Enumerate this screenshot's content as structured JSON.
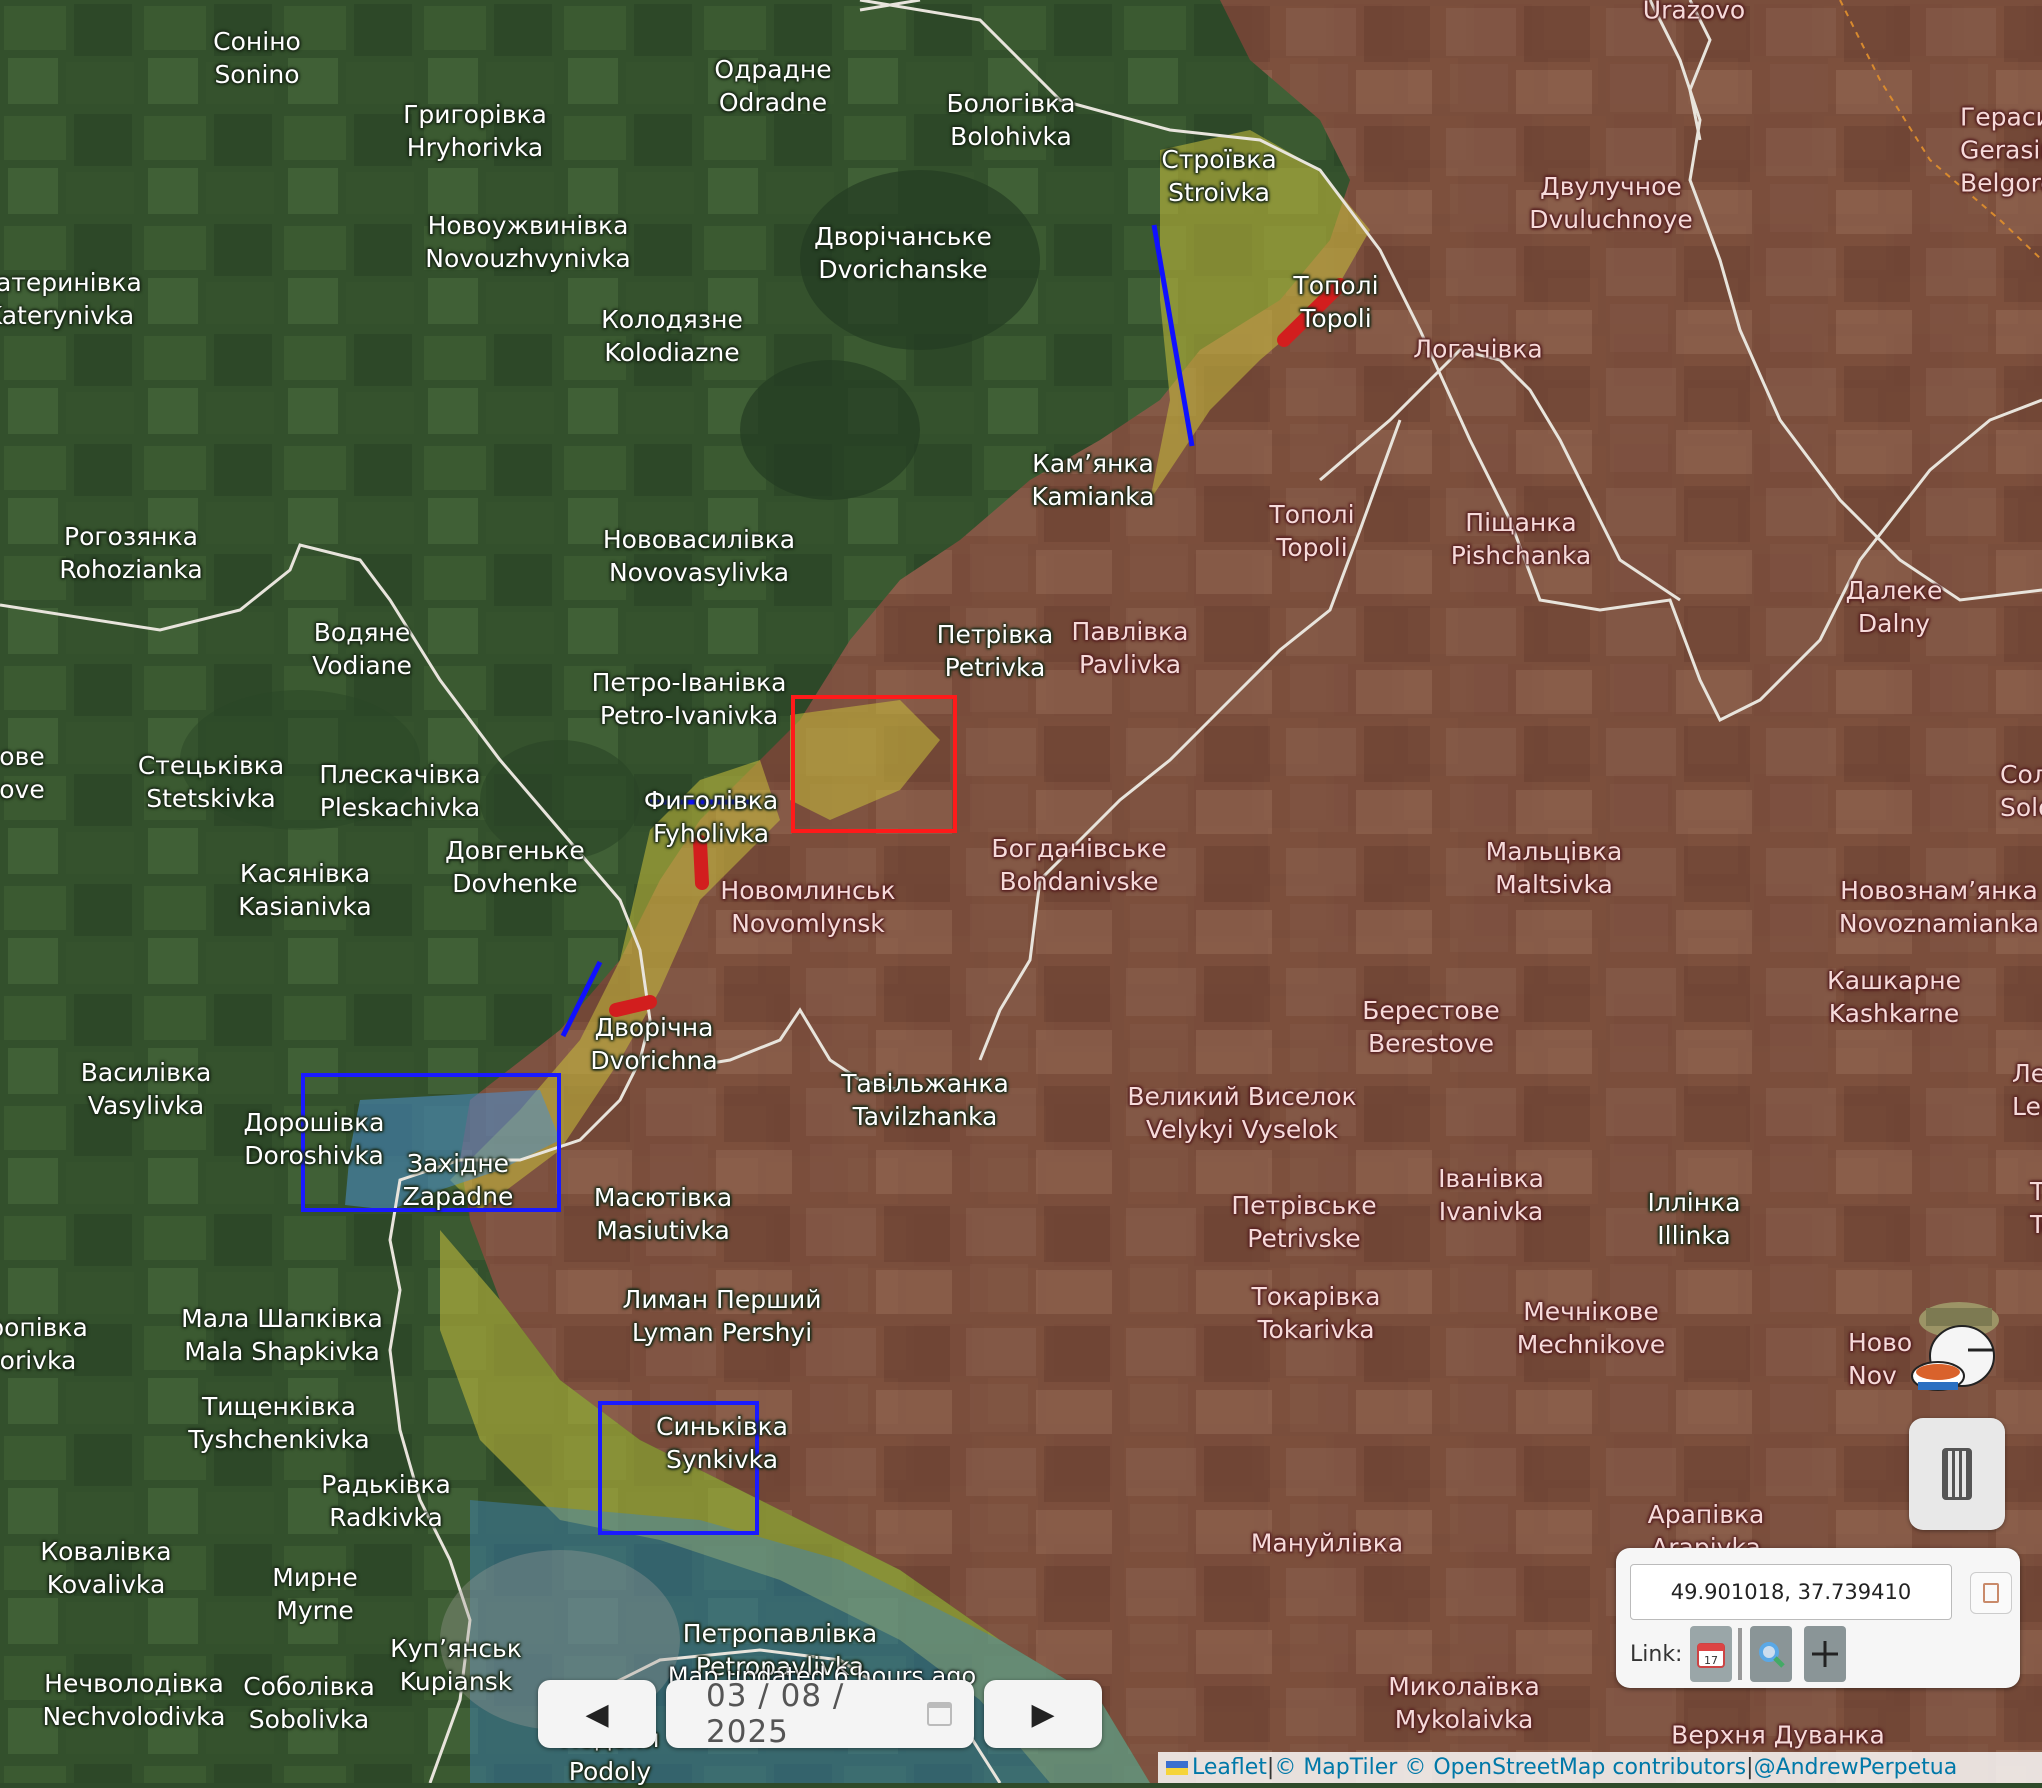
{
  "map": {
    "colors": {
      "ukraine_held": "#2f5a2c",
      "russian_occupied": "#7a3f33",
      "contested": "#b8b63a",
      "liberated": "#3f85bf",
      "border": "#e8e4dc",
      "highlight_red": "#ff0000",
      "highlight_blue": "#0000ff"
    },
    "places": [
      {
        "uk": "Соніно",
        "en": "Sonino",
        "side": "ua"
      },
      {
        "uk": "Одрадне",
        "en": "Odradne",
        "side": "ua"
      },
      {
        "uk": "Бологівка",
        "en": "Bolohivka",
        "side": "ua"
      },
      {
        "uk": "Григорівка",
        "en": "Hryhorivka",
        "side": "ua"
      },
      {
        "uk": "Строївка",
        "en": "Stroivka",
        "side": "ua"
      },
      {
        "uk": "Двулучное",
        "en": "Dvuluchnoye",
        "side": "ru"
      },
      {
        "uk": "Герасимівка",
        "en": "Gerasimovka",
        "side": "ru"
      },
      {
        "uk": "Новоужвинівка",
        "en": "Novouzhvynivka",
        "side": "ua"
      },
      {
        "uk": "Дворічанське",
        "en": "Dvorichanske",
        "side": "ua"
      },
      {
        "uk": "Катеринівка",
        "en": "Katerynivka",
        "side": "ua"
      },
      {
        "uk": "Колодязне",
        "en": "Kolodiazne",
        "side": "ua"
      },
      {
        "uk": "Тополі",
        "en": "Topoli",
        "side": "ua"
      },
      {
        "uk": "Логачівка",
        "en": "",
        "side": "ru"
      },
      {
        "uk": "Кам’янка",
        "en": "Kamianka",
        "side": "ua"
      },
      {
        "uk": "Тополі",
        "en": "Topoli",
        "side": "ru"
      },
      {
        "uk": "Піщанка",
        "en": "Pishchanka",
        "side": "ru"
      },
      {
        "uk": "Рогозянка",
        "en": "Rohozianka",
        "side": "ua"
      },
      {
        "uk": "Нововасилівка",
        "en": "Novovasylivka",
        "side": "ua"
      },
      {
        "uk": "Далеке",
        "en": "Dalny",
        "side": "ru"
      },
      {
        "uk": "Водяне",
        "en": "Vodiane",
        "side": "ua"
      },
      {
        "uk": "Петрівка",
        "en": "Petrivka",
        "side": "ua"
      },
      {
        "uk": "Павлівка",
        "en": "Pavlivka",
        "side": "ru"
      },
      {
        "uk": "Петро-Іванівка",
        "en": "Petro-Ivanivka",
        "side": "ua"
      },
      {
        "uk": "Стецьківка",
        "en": "Stetskivka",
        "side": "ua"
      },
      {
        "uk": "Плескачівка",
        "en": "Pleskachivka",
        "side": "ua"
      },
      {
        "uk": "Фиголівка",
        "en": "Fyholivka",
        "side": "ua"
      },
      {
        "uk": "Солонці",
        "en": "Solontsi",
        "side": "ru"
      },
      {
        "uk": "Богданівське",
        "en": "Bohdanivske",
        "side": "ru"
      },
      {
        "uk": "Мальцівка",
        "en": "Maltsivka",
        "side": "ru"
      },
      {
        "uk": "Касянівка",
        "en": "Kasianivka",
        "side": "ua"
      },
      {
        "uk": "Довгеньке",
        "en": "Dovhenke",
        "side": "ua"
      },
      {
        "uk": "Новомлинськ",
        "en": "Novomlynsk",
        "side": "ru"
      },
      {
        "uk": "Новознам’янка",
        "en": "Novoznamianka",
        "side": "ru"
      },
      {
        "uk": "Кашкарне",
        "en": "Kashkarne",
        "side": "ru"
      },
      {
        "uk": "Берестове",
        "en": "Berestove",
        "side": "ru"
      },
      {
        "uk": "Дворічна",
        "en": "Dvorichna",
        "side": "ua"
      },
      {
        "uk": "Василівка",
        "en": "Vasylivka",
        "side": "ua"
      },
      {
        "uk": "Тавільжанка",
        "en": "Tavilzhanka",
        "side": "ua"
      },
      {
        "uk": "Великий Виселок",
        "en": "Velykyi Vyselok",
        "side": "ru"
      },
      {
        "uk": "Дорошівка",
        "en": "Doroshivka",
        "side": "ua"
      },
      {
        "uk": "Західне",
        "en": "Zapadne",
        "side": "ua"
      },
      {
        "uk": "Іванівка",
        "en": "Ivanivka",
        "side": "ru"
      },
      {
        "uk": "Петрівське",
        "en": "Petrivske",
        "side": "ru"
      },
      {
        "uk": "Масютівка",
        "en": "Masiutivka",
        "side": "ua"
      },
      {
        "uk": "Іллінка",
        "en": "Illinka",
        "side": "ua"
      },
      {
        "uk": "Лиман Перший",
        "en": "Lyman Pershyi",
        "side": "ua"
      },
      {
        "uk": "Токарівка",
        "en": "Tokarivka",
        "side": "ru"
      },
      {
        "uk": "Мечнікове",
        "en": "Mechnikove",
        "side": "ru"
      },
      {
        "uk": "Мала Шапківка",
        "en": "Mala Shapkivka",
        "side": "ua"
      },
      {
        "uk": "Тищенківка",
        "en": "Tyshchenkivka",
        "side": "ua"
      },
      {
        "uk": "Синьківка",
        "en": "Synkivka",
        "side": "ua"
      },
      {
        "uk": "Радьківка",
        "en": "Radkivka",
        "side": "ua"
      },
      {
        "uk": "Арапівка",
        "en": "Arapivka",
        "side": "ru"
      },
      {
        "uk": "Мануйлівка",
        "en": "",
        "side": "ru"
      },
      {
        "uk": "Ковалівка",
        "en": "Kovalivka",
        "side": "ua"
      },
      {
        "uk": "Мирне",
        "en": "Myrne",
        "side": "ua"
      },
      {
        "uk": "Петропавлівка",
        "en": "Petropavlivka",
        "side": "ua"
      },
      {
        "uk": "Куп’янськ",
        "en": "Kupiansk",
        "side": "ua"
      },
      {
        "uk": "Нечволодівка",
        "en": "Nechvolodivka",
        "side": "ua"
      },
      {
        "uk": "Соболівка",
        "en": "Sobolivka",
        "side": "ua"
      },
      {
        "uk": "Миколаївка",
        "en": "Mykolaivka",
        "side": "ru"
      },
      {
        "uk": "Подоли",
        "en": "Podoly",
        "side": "ua"
      },
      {
        "uk": "Верхня Дуванка",
        "en": "",
        "side": "ru"
      },
      {
        "uk": "",
        "en": "Urazovo",
        "side": "ru"
      },
      {
        "uk": "",
        "en": "Belgorod Ob",
        "side": "ru"
      },
      {
        "uk": "Лем",
        "en": "Lem",
        "side": "ru"
      },
      {
        "uk": "То",
        "en": "To",
        "side": "ru"
      },
      {
        "uk": "Ново",
        "en": "Nov",
        "side": "ru"
      },
      {
        "uk": "ропівка",
        "en": "orivka",
        "side": "ua"
      },
      {
        "uk": "ове",
        "en": "ove",
        "side": "ua"
      }
    ]
  },
  "status": {
    "updated": "Map updated 6 hours ago"
  },
  "datenav": {
    "prev_icon": "◀",
    "date": "03 / 08 / 2025",
    "next_icon": "▶",
    "calendar_icon": "calendar-icon"
  },
  "coords": {
    "value": "49.901018, 37.739410",
    "link_label": "Link:",
    "copy_icon": "clipboard-icon",
    "link_date_icon": "calendar-icon",
    "link_zoom_icon": "magnifier-icon",
    "link_cross_icon": "crosshair-icon"
  },
  "attribution": {
    "leaflet": "Leaflet",
    "sep1": " | ",
    "maptiler": "© MapTiler",
    "osm": "© OpenStreetMap contributors",
    "sep2": " | ",
    "author": "@AndrewPerpetua"
  }
}
